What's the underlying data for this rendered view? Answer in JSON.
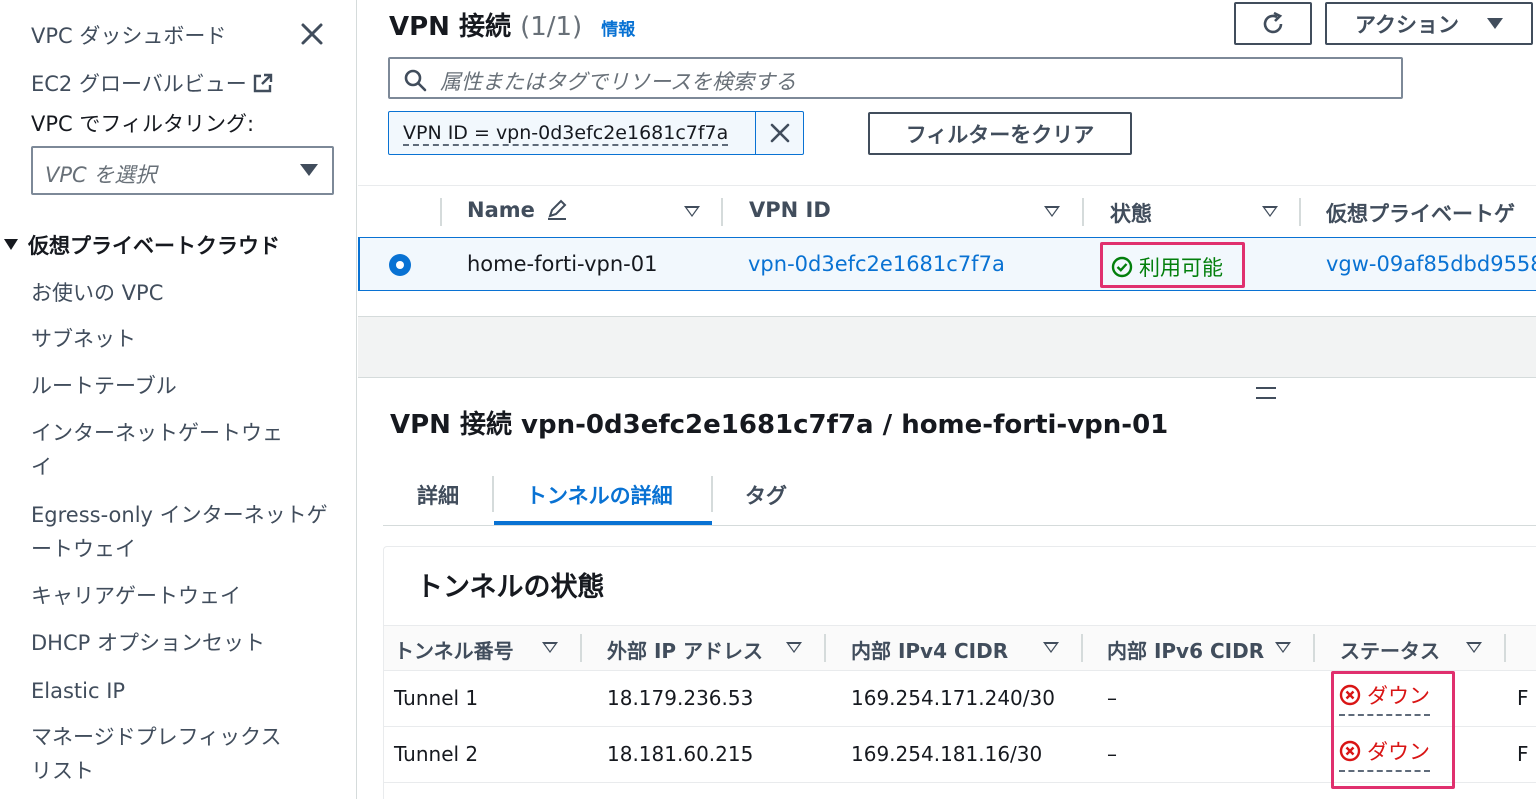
{
  "sidebar": {
    "dashboard": "VPC ダッシュボード",
    "ec2_global_view": "EC2 グローバルビュー",
    "filter_label": "VPC でフィルタリング:",
    "select_placeholder": "VPC を選択",
    "section_title": "仮想プライベートクラウド",
    "items": [
      "お使いの VPC",
      "サブネット",
      "ルートテーブル",
      "インターネットゲートウェイ",
      "Egress-only インターネットゲートウェイ",
      "キャリアゲートウェイ",
      "DHCP オプションセット",
      "Elastic IP",
      "マネージドプレフィックスリスト"
    ]
  },
  "header": {
    "title": "VPN 接続",
    "count": "(1/1)",
    "info": "情報",
    "actions_label": "アクション",
    "search_placeholder": "属性またはタグでリソースを検索する",
    "filter_token": "VPN ID = vpn-0d3efc2e1681c7f7a",
    "clear_filters": "フィルターをクリア"
  },
  "table": {
    "columns": [
      "Name",
      "VPN ID",
      "状態",
      "仮想プライベートゲ"
    ],
    "row": {
      "name": "home-forti-vpn-01",
      "vpn_id": "vpn-0d3efc2e1681c7f7a",
      "state": "利用可能",
      "vgw": "vgw-09af85dbd9558"
    }
  },
  "detail": {
    "title": "VPN 接続 vpn-0d3efc2e1681c7f7a / home-forti-vpn-01",
    "tabs": [
      "詳細",
      "トンネルの詳細",
      "タグ"
    ],
    "active_tab": "トンネルの詳細",
    "panel_title": "トンネルの状態",
    "columns": [
      "トンネル番号",
      "外部 IP アドレス",
      "内部 IPv4 CIDR",
      "内部 IPv6 CIDR",
      "ステータス"
    ],
    "rows": [
      {
        "tunnel": "Tunnel 1",
        "outside_ip": "18.179.236.53",
        "ipv4_cidr": "169.254.171.240/30",
        "ipv6_cidr": "–",
        "status": "ダウン",
        "extra": "F"
      },
      {
        "tunnel": "Tunnel 2",
        "outside_ip": "18.181.60.215",
        "ipv4_cidr": "169.254.181.16/30",
        "ipv6_cidr": "–",
        "status": "ダウン",
        "extra": "F"
      }
    ]
  },
  "colors": {
    "link": "#0972d3",
    "success": "#037f0c",
    "error": "#d91515",
    "highlight": "#e0306e"
  }
}
